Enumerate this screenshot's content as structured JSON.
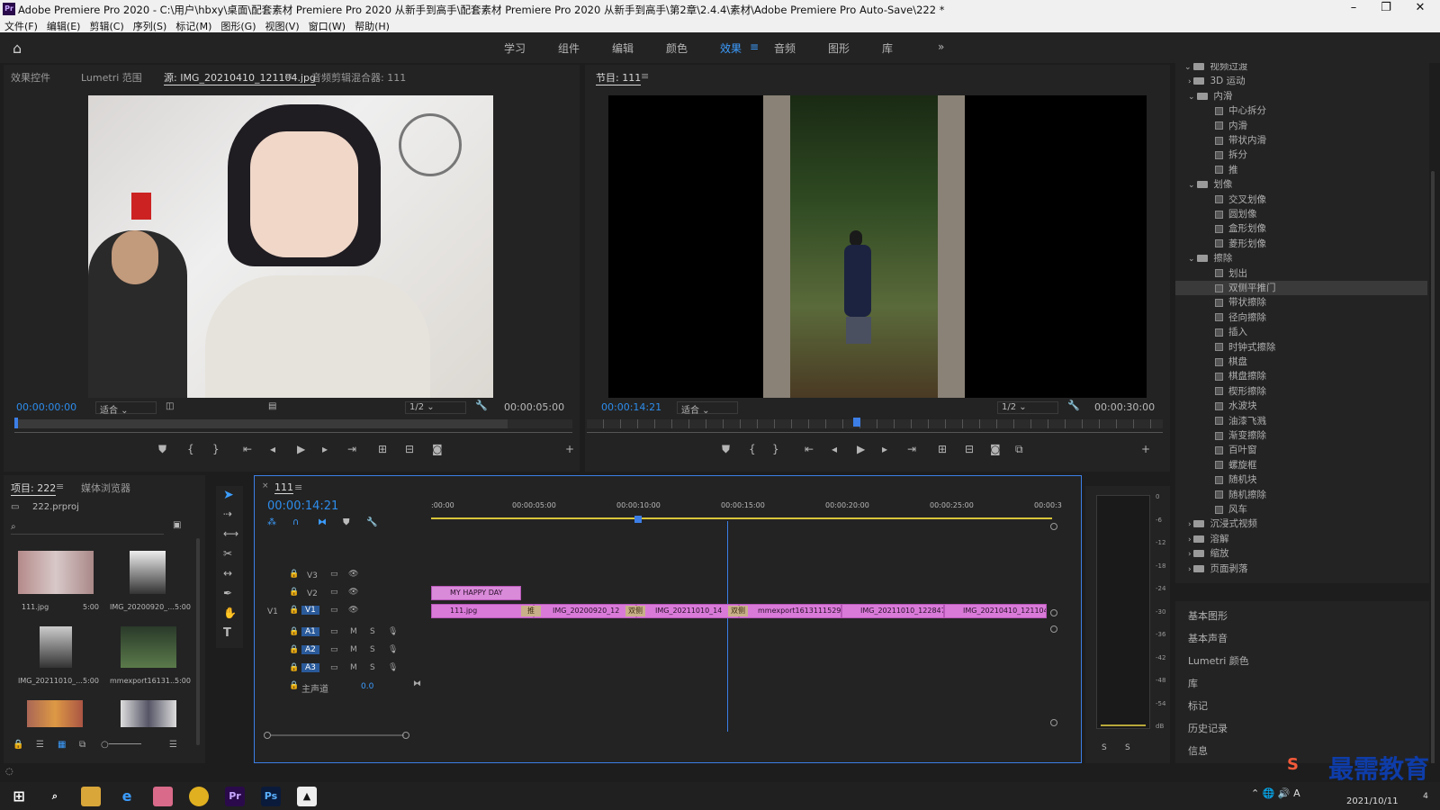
{
  "titlebar": {
    "title": "Adobe Premiere Pro 2020 - C:\\用户\\hbxy\\桌面\\配套素材 Premiere Pro 2020 从新手到高手\\配套素材 Premiere Pro 2020 从新手到高手\\第2章\\2.4.4\\素材\\Adobe Premiere Pro Auto-Save\\222 *",
    "logo": "Pr"
  },
  "menu": [
    "文件(F)",
    "编辑(E)",
    "剪辑(C)",
    "序列(S)",
    "标记(M)",
    "图形(G)",
    "视图(V)",
    "窗口(W)",
    "帮助(H)"
  ],
  "workspaces": [
    "学习",
    "组件",
    "编辑",
    "颜色",
    "效果",
    "音频",
    "图形",
    "库"
  ],
  "active_workspace": "效果",
  "source_panel": {
    "tabs": [
      "效果控件",
      "Lumetri 范围",
      "源: IMG_20210410_121104.jpg",
      "音频剪辑混合器: 111"
    ],
    "timecode": "00:00:00:00",
    "fit": "适合",
    "resolution": "1/2",
    "duration": "00:00:05:00"
  },
  "program_panel": {
    "tab": "节目: 111",
    "timecode": "00:00:14:21",
    "fit": "适合",
    "resolution": "1/2",
    "duration": "00:00:30:00"
  },
  "project_panel": {
    "tabs": [
      "项目: 222",
      "媒体浏览器"
    ],
    "file": "222.prproj",
    "items": [
      {
        "name": "111.jpg",
        "dur": "5:00"
      },
      {
        "name": "IMG_20200920_...",
        "dur": "5:00"
      },
      {
        "name": "IMG_20211010_...",
        "dur": "5:00"
      },
      {
        "name": "mmexport16131...",
        "dur": "5:00"
      }
    ]
  },
  "timeline": {
    "tab": "111",
    "timecode": "00:00:14:21",
    "ruler": [
      ":00:00",
      "00:00:05:00",
      "00:00:10:00",
      "00:00:15:00",
      "00:00:20:00",
      "00:00:25:00",
      "00:00:3"
    ],
    "tracks": [
      "V3",
      "V2",
      "V1",
      "A1",
      "A2",
      "A3"
    ],
    "v1_label": "V1",
    "msm": [
      "M",
      "S"
    ],
    "master": "主声道",
    "master_value": "0.0",
    "v2_clip": "MY HAPPY DAY",
    "v1_clips": [
      "111.jpg",
      "IMG_20200920_12",
      "IMG_20211010_14",
      "mmexport1613111529",
      "IMG_20211010_122847.j",
      "IMG_20210410_121104.jp"
    ],
    "transitions": [
      "推",
      "双侧",
      "双侧"
    ]
  },
  "meter_scale": [
    "0",
    "-6",
    "-12",
    "-18",
    "-24",
    "-30",
    "-36",
    "-42",
    "-48",
    "-54",
    "dB"
  ],
  "meter_solo": [
    "S",
    "S"
  ],
  "effects_tree": [
    {
      "label": "视频过渡",
      "type": "folder",
      "level": 0
    },
    {
      "label": "3D 运动",
      "type": "folder-collapsed",
      "level": 1
    },
    {
      "label": "内滑",
      "type": "folder",
      "level": 1
    },
    {
      "label": "中心拆分",
      "type": "item",
      "level": 2
    },
    {
      "label": "内滑",
      "type": "item",
      "level": 2
    },
    {
      "label": "带状内滑",
      "type": "item",
      "level": 2
    },
    {
      "label": "拆分",
      "type": "item",
      "level": 2
    },
    {
      "label": "推",
      "type": "item",
      "level": 2
    },
    {
      "label": "划像",
      "type": "folder",
      "level": 1
    },
    {
      "label": "交叉划像",
      "type": "item",
      "level": 2
    },
    {
      "label": "圆划像",
      "type": "item",
      "level": 2
    },
    {
      "label": "盒形划像",
      "type": "item",
      "level": 2
    },
    {
      "label": "菱形划像",
      "type": "item",
      "level": 2
    },
    {
      "label": "擦除",
      "type": "folder",
      "level": 1
    },
    {
      "label": "划出",
      "type": "item",
      "level": 2
    },
    {
      "label": "双侧平推门",
      "type": "item",
      "level": 2,
      "selected": true
    },
    {
      "label": "带状擦除",
      "type": "item",
      "level": 2
    },
    {
      "label": "径向擦除",
      "type": "item",
      "level": 2
    },
    {
      "label": "插入",
      "type": "item",
      "level": 2
    },
    {
      "label": "时钟式擦除",
      "type": "item",
      "level": 2
    },
    {
      "label": "棋盘",
      "type": "item",
      "level": 2
    },
    {
      "label": "棋盘擦除",
      "type": "item",
      "level": 2
    },
    {
      "label": "楔形擦除",
      "type": "item",
      "level": 2
    },
    {
      "label": "水波块",
      "type": "item",
      "level": 2
    },
    {
      "label": "油漆飞溅",
      "type": "item",
      "level": 2
    },
    {
      "label": "渐变擦除",
      "type": "item",
      "level": 2
    },
    {
      "label": "百叶窗",
      "type": "item",
      "level": 2
    },
    {
      "label": "螺旋框",
      "type": "item",
      "level": 2
    },
    {
      "label": "随机块",
      "type": "item",
      "level": 2
    },
    {
      "label": "随机擦除",
      "type": "item",
      "level": 2
    },
    {
      "label": "风车",
      "type": "item",
      "level": 2
    },
    {
      "label": "沉浸式视频",
      "type": "folder-collapsed",
      "level": 1
    },
    {
      "label": "溶解",
      "type": "folder-collapsed",
      "level": 1
    },
    {
      "label": "缩放",
      "type": "folder-collapsed",
      "level": 1
    },
    {
      "label": "页面剥落",
      "type": "folder-collapsed",
      "level": 1
    }
  ],
  "side_panels": [
    "基本图形",
    "基本声音",
    "Lumetri 颜色",
    "库",
    "标记",
    "历史记录",
    "信息"
  ],
  "taskbar": {
    "date": "2021/10/11",
    "watermark": "最需教育",
    "pr_label": "Pr",
    "ps_label": "Ps",
    "ime": "A",
    "badge": "4"
  },
  "colors": {
    "accent": "#2d8ceb",
    "clip": "#d97ad9",
    "playhead": "#3c7ee6"
  }
}
